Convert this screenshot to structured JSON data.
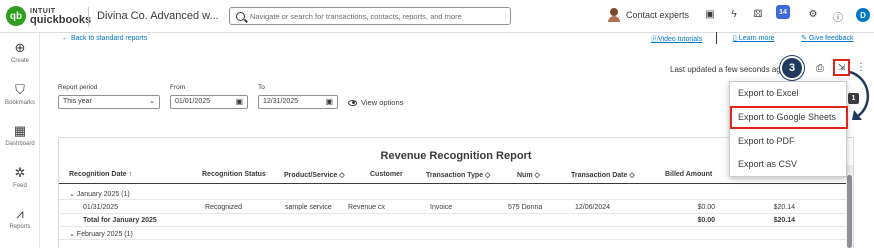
{
  "topbar": {
    "logo_mark": "qb",
    "logo_line1": "INTUIT",
    "logo_line2": "quickbooks",
    "company": "Divina Co. Advanced w...",
    "search_placeholder": "Navigate or search for transactions, contacts, reports, and more",
    "contact_experts": "Contact experts",
    "notification_count": "14",
    "user_initial": "D"
  },
  "leftnav": {
    "items": [
      {
        "label": "Create",
        "icon": "plus-circle-icon",
        "glyph": "⊕"
      },
      {
        "label": "Bookmarks",
        "icon": "bookmark-icon",
        "glyph": "⛉"
      },
      {
        "label": "Dashboard",
        "icon": "dashboard-icon",
        "glyph": "▦"
      },
      {
        "label": "Feed",
        "icon": "feed-icon",
        "glyph": "✲"
      },
      {
        "label": "Reports",
        "icon": "reports-icon",
        "glyph": "⩘"
      }
    ]
  },
  "links": {
    "back": "← Back to standard reports",
    "video_tutorials": "Video tutorials",
    "learn_more": "Learn more",
    "give_feedback": "Give feedback"
  },
  "toolbar": {
    "last_updated": "Last updated a few seconds ago",
    "step_number": "3"
  },
  "filters": {
    "report_period_label": "Report period",
    "report_period_value": "This year",
    "from_label": "From",
    "from_value": "01/01/2025",
    "to_label": "To",
    "to_value": "12/31/2025",
    "view_options": "View options"
  },
  "export_menu": {
    "items": [
      "Export to Excel",
      "Export to Google Sheets",
      "Export to PDF",
      "Export as CSV"
    ],
    "badge": "1"
  },
  "report": {
    "title": "Revenue Recognition Report",
    "columns": [
      "Recognition Date ↑",
      "Recognition Status",
      "Product/Service ◇",
      "Customer",
      "Transaction Type ◇",
      "Num ◇",
      "Transaction Date ◇",
      "Billed Amount",
      ""
    ],
    "rows": [
      {
        "type": "group",
        "label": "⌄ January 2025 (1)"
      },
      {
        "type": "data",
        "date": "01/31/2025",
        "status": "Recognized",
        "product": "sample service",
        "customer": "Revenue cx",
        "txn_type": "Invoice",
        "num": "575 Donna",
        "txn_date": "12/06/2024",
        "billed": "$0.00",
        "last": "$20.14"
      },
      {
        "type": "total",
        "label": "Total for January 2025",
        "billed": "$0.00",
        "last": "$20.14"
      },
      {
        "type": "group",
        "label": "⌄ February 2025 (1)"
      }
    ]
  },
  "colors": {
    "brand_green": "#2ca01c",
    "link_blue": "#0077c5",
    "highlight_red": "#e0261a",
    "step_navy": "#1e3a5f"
  }
}
